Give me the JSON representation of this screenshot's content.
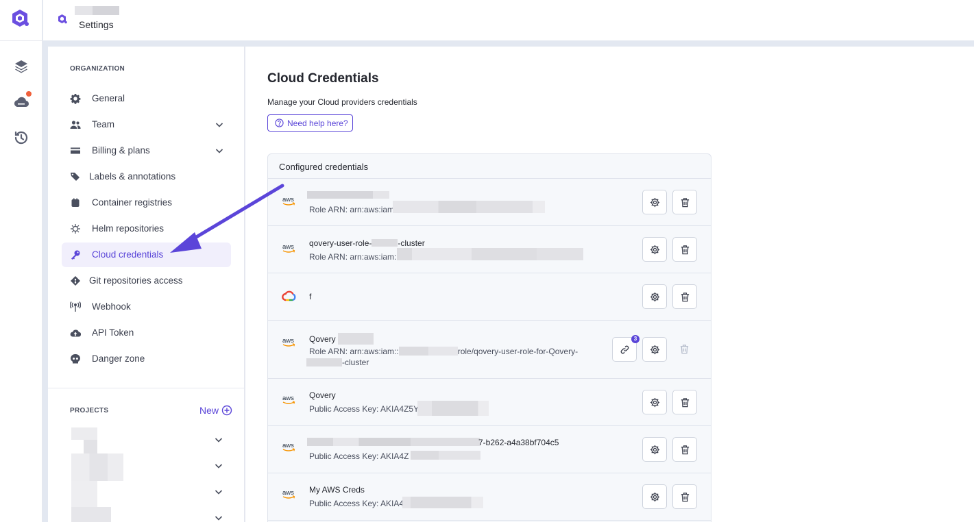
{
  "header": {
    "title": "Settings"
  },
  "sidebar": {
    "organization_title": "ORGANIZATION",
    "items": [
      {
        "label": "General",
        "icon": "gear-icon"
      },
      {
        "label": "Team",
        "icon": "users-icon"
      },
      {
        "label": "Billing & plans",
        "icon": "credit-card-icon"
      },
      {
        "label": "Labels & annotations",
        "icon": "tags-icon"
      },
      {
        "label": "Container registries",
        "icon": "box-icon"
      },
      {
        "label": "Helm repositories",
        "icon": "helm-icon"
      },
      {
        "label": "Cloud credentials",
        "icon": "key-icon"
      },
      {
        "label": "Git repositories access",
        "icon": "git-icon"
      },
      {
        "label": "Webhook",
        "icon": "webhook-icon"
      },
      {
        "label": "API Token",
        "icon": "cloud-upload-icon"
      },
      {
        "label": "Danger zone",
        "icon": "skull-icon"
      }
    ],
    "projects_title": "PROJECTS",
    "new_label": "New"
  },
  "main": {
    "title": "Cloud Credentials",
    "subtitle": "Manage your Cloud providers credentials",
    "help_label": "Need help here?",
    "panel_title": "Configured credentials",
    "credentials": [
      {
        "provider": "aws",
        "name": "",
        "detail": "Role ARN: arn:aws:iam"
      },
      {
        "provider": "aws",
        "name": "qovery-user-role-",
        "name_suffix": "-cluster",
        "detail": "Role ARN: arn:aws:iam::"
      },
      {
        "provider": "gcp",
        "name": "f",
        "detail": ""
      },
      {
        "provider": "aws",
        "name": "Qovery",
        "detail": "Role ARN: arn:aws:iam::",
        "detail_mid": "role/qovery-user-role-for-Qovery-",
        "detail_end": "-cluster",
        "linked_count": "3"
      },
      {
        "provider": "aws",
        "name": "Qovery",
        "detail": "Public Access Key: AKIA4Z5Y"
      },
      {
        "provider": "aws",
        "name": "",
        "name_suffix": "7-b262-a4a38bf704c5",
        "detail": "Public Access Key: AKIA4Z"
      },
      {
        "provider": "aws",
        "name": "My AWS Creds",
        "detail": "Public Access Key: AKIA4"
      }
    ]
  }
}
